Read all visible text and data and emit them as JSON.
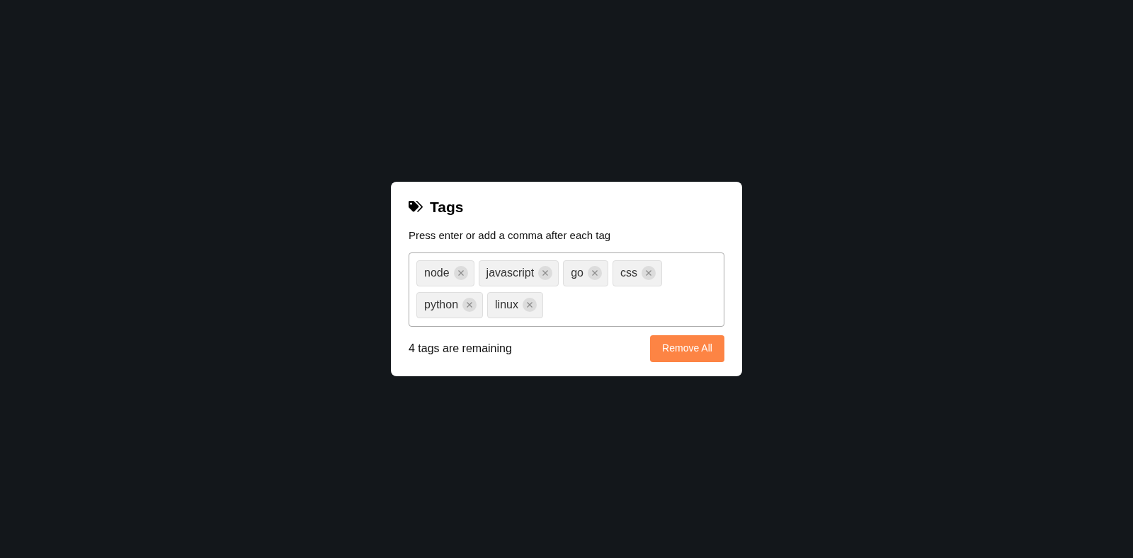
{
  "card": {
    "title": "Tags",
    "hint": "Press enter or add a comma after each tag",
    "tags": [
      {
        "label": "node"
      },
      {
        "label": "javascript"
      },
      {
        "label": "go"
      },
      {
        "label": "css"
      },
      {
        "label": "python"
      },
      {
        "label": "linux"
      }
    ],
    "remaining": "4 tags are remaining",
    "button": "Remove All"
  }
}
